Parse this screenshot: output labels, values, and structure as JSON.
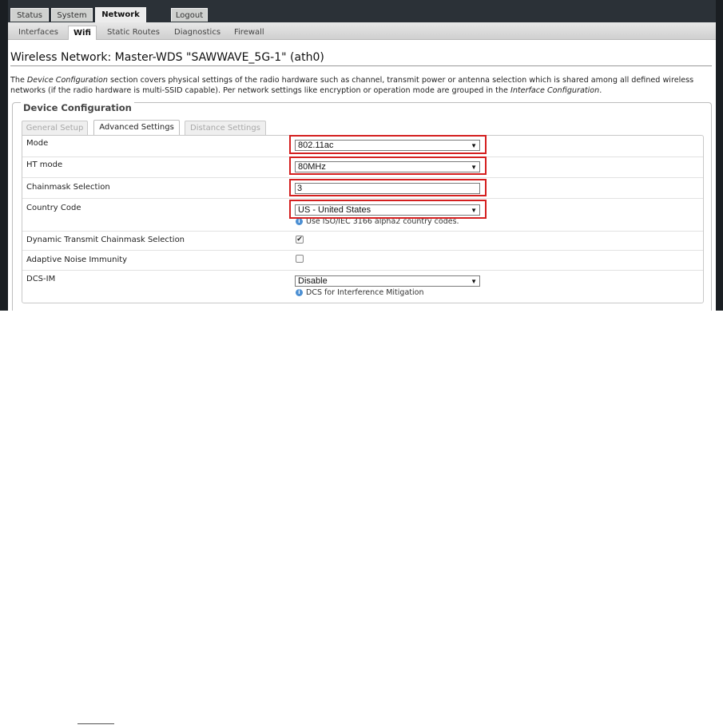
{
  "main_tabs": [
    "Status",
    "System",
    "Network",
    "Logout"
  ],
  "sub_tabs": [
    "Interfaces",
    "Wifi",
    "Static Routes",
    "Diagnostics",
    "Firewall"
  ],
  "page_title": "Wireless Network: Master-WDS \"SAWWAVE_5G-1\" (ath0)",
  "description": {
    "p1": "The ",
    "em1": "Device Configuration",
    "p2": " section covers physical settings of the radio hardware such as channel, transmit power or antenna selection which is shared among all defined wireless networks (if the radio hardware is multi-SSID capable). Per network settings like encryption or operation mode are grouped in the ",
    "em2": "Interface Configuration",
    "p3": "."
  },
  "device_config": {
    "legend": "Device Configuration",
    "tabs": [
      "General Setup",
      "Advanced Settings",
      "Distance Settings"
    ],
    "active_tab": "Advanced Settings",
    "fields": {
      "mode": {
        "label": "Mode",
        "value": "802.11ac"
      },
      "ht_mode": {
        "label": "HT mode",
        "value": "80MHz"
      },
      "chainmask": {
        "label": "Chainmask Selection",
        "value": "3"
      },
      "country": {
        "label": "Country Code",
        "value": "US - United States",
        "hint": "Use ISO/IEC 3166 alpha2 country codes."
      },
      "dyn_chainmask": {
        "label": "Dynamic Transmit Chainmask Selection",
        "checked": true
      },
      "ani": {
        "label": "Adaptive Noise Immunity",
        "checked": false
      },
      "dcs": {
        "label": "DCS-IM",
        "value": "Disable",
        "hint": "DCS for Interference Mitigation"
      }
    }
  },
  "colors": {
    "highlight": "#d41f1f",
    "info_icon": "#4b8fd3"
  },
  "icons": {
    "dropdown": "chevron-down-icon",
    "info": "info-icon",
    "check": "checkmark-icon"
  }
}
